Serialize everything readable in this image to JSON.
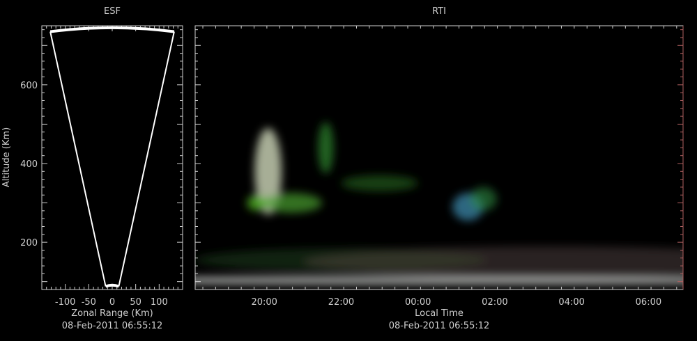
{
  "chart_data": [
    {
      "type": "fan",
      "title": "ESF",
      "xlabel": "Zonal Range (Km)",
      "ylabel": "Altitude (Km)",
      "date": "08-Feb-2011 06:55:12",
      "xlim": [
        -150,
        150
      ],
      "ylim": [
        80,
        750
      ],
      "xticks": [
        -100,
        -50,
        0,
        50,
        100
      ],
      "yticks": [
        200,
        400,
        600
      ],
      "fan": {
        "inner_altitude": 88,
        "outer_altitude": 745,
        "inner_left_x": -14,
        "inner_right_x": 14,
        "outer_left_x": -132,
        "outer_right_x": 132
      },
      "colors": {
        "axis": "#d0d0d0",
        "outline": "#ffffff"
      }
    },
    {
      "type": "heatmap",
      "title": "RTI",
      "xlabel": "Local Time",
      "date": "08-Feb-2011 06:55:12",
      "xlim": [
        18.2,
        30.9
      ],
      "ylim": [
        80,
        750
      ],
      "xticks": [
        "20:00",
        "22:00",
        "00:00",
        "02:00",
        "04:00",
        "06:00"
      ],
      "xtick_values": [
        20,
        22,
        24,
        26,
        28,
        30
      ],
      "yticks": [
        200,
        400,
        600
      ],
      "features": [
        {
          "t": 20.1,
          "alt": 380,
          "dt": 0.35,
          "dalt": 220,
          "color": "#dfe8c8",
          "opacity": 0.75
        },
        {
          "t": 20.7,
          "alt": 300,
          "dt": 0.8,
          "dalt": 50,
          "color": "#4aa030",
          "opacity": 0.7
        },
        {
          "t": 19.8,
          "alt": 300,
          "dt": 0.25,
          "dalt": 40,
          "color": "#50b020",
          "opacity": 0.8
        },
        {
          "t": 21.6,
          "alt": 440,
          "dt": 0.2,
          "dalt": 130,
          "color": "#2f8a30",
          "opacity": 0.7
        },
        {
          "t": 23.0,
          "alt": 350,
          "dt": 1.0,
          "dalt": 40,
          "color": "#2a6a20",
          "opacity": 0.6
        },
        {
          "t": 25.3,
          "alt": 290,
          "dt": 0.4,
          "dalt": 70,
          "color": "#3a7fa0",
          "opacity": 0.8
        },
        {
          "t": 25.7,
          "alt": 310,
          "dt": 0.35,
          "dalt": 60,
          "color": "#2f8a40",
          "opacity": 0.6
        },
        {
          "t": 22.0,
          "alt": 155,
          "dt": 3.8,
          "dalt": 60,
          "color": "#1f4a20",
          "opacity": 0.45
        },
        {
          "t": 27.4,
          "alt": 150,
          "dt": 6.4,
          "dalt": 80,
          "color": "#5a4a4a",
          "opacity": 0.45
        },
        {
          "t": 24.5,
          "alt": 103,
          "dt": 12.3,
          "dalt": 22,
          "color": "#d8dcd8",
          "opacity": 0.7
        }
      ],
      "colors": {
        "axis": "#d0d0d0",
        "right_axis": "#b06060"
      }
    }
  ]
}
